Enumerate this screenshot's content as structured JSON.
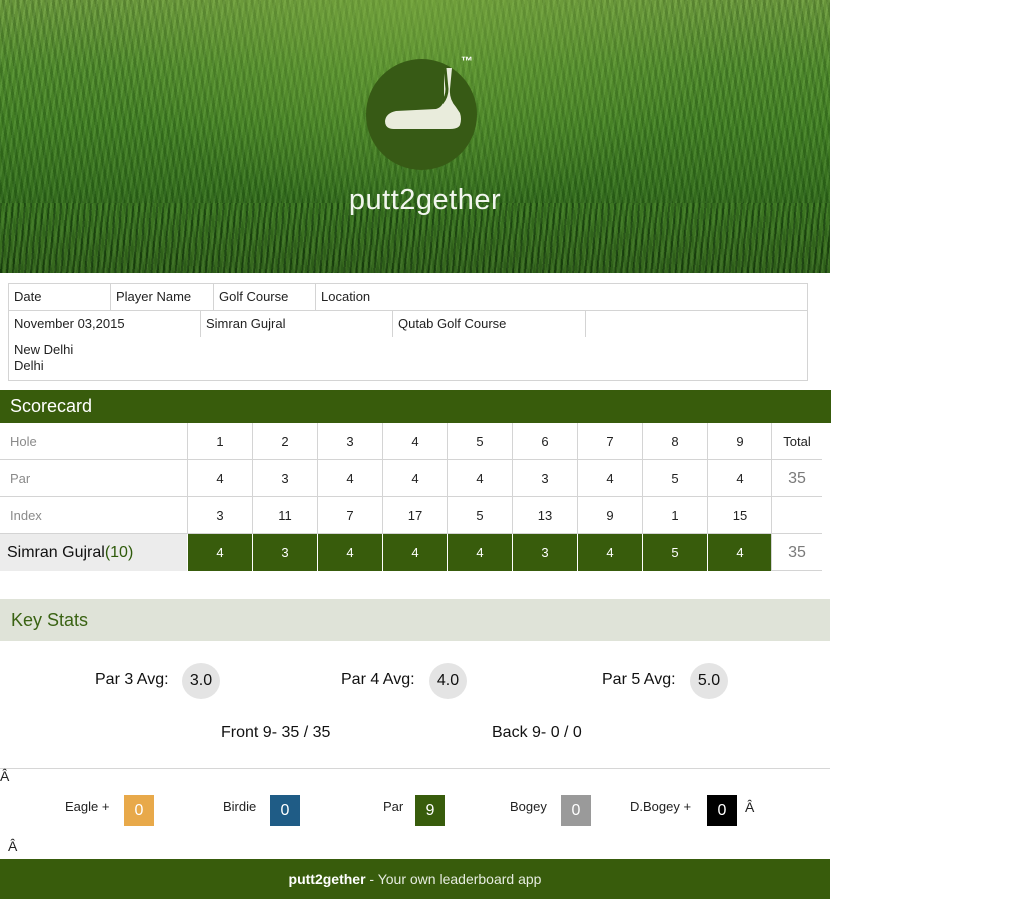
{
  "brand": {
    "name": "putt2gether",
    "tm": "™"
  },
  "info": {
    "headers": [
      "Date",
      "Player Name",
      "Golf Course",
      "Location"
    ],
    "date": "November 03,2015",
    "player": "Simran Gujral",
    "course": "Qutab Golf Course",
    "location_line1": "New Delhi",
    "location_line2": "Delhi"
  },
  "scorecard": {
    "title": "Scorecard",
    "hole_label": "Hole",
    "par_label": "Par",
    "index_label": "Index",
    "total_label": "Total",
    "holes": [
      "1",
      "2",
      "3",
      "4",
      "5",
      "6",
      "7",
      "8",
      "9"
    ],
    "par": [
      "4",
      "3",
      "4",
      "4",
      "4",
      "3",
      "4",
      "5",
      "4"
    ],
    "par_total": "35",
    "index": [
      "3",
      "11",
      "7",
      "17",
      "5",
      "13",
      "9",
      "1",
      "15"
    ],
    "player_name": "Simran Gujral",
    "player_handicap": "(10)",
    "scores": [
      "4",
      "3",
      "4",
      "4",
      "4",
      "3",
      "4",
      "5",
      "4"
    ],
    "score_total": "35"
  },
  "key_stats": {
    "title": "Key Stats",
    "par3_label": "Par 3 Avg:",
    "par3_value": "3.0",
    "par4_label": "Par 4 Avg:",
    "par4_value": "4.0",
    "par5_label": "Par 5 Avg:",
    "par5_value": "5.0",
    "front9": "Front 9- 35 / 35",
    "back9": "Back 9- 0 / 0",
    "stray_glyph": "Â",
    "categories": [
      {
        "label": "Eagle +",
        "value": "0",
        "color": "#e8a94a"
      },
      {
        "label": "Birdie",
        "value": "0",
        "color": "#1f5c86"
      },
      {
        "label": "Par",
        "value": "9",
        "color": "#385c0c"
      },
      {
        "label": "Bogey",
        "value": "0",
        "color": "#9a9a9a"
      },
      {
        "label": "D.Bogey +",
        "value": "0",
        "color": "#000000"
      }
    ]
  },
  "footer": {
    "brand": "putt2gether",
    "tagline": " - Your own leaderboard app"
  }
}
